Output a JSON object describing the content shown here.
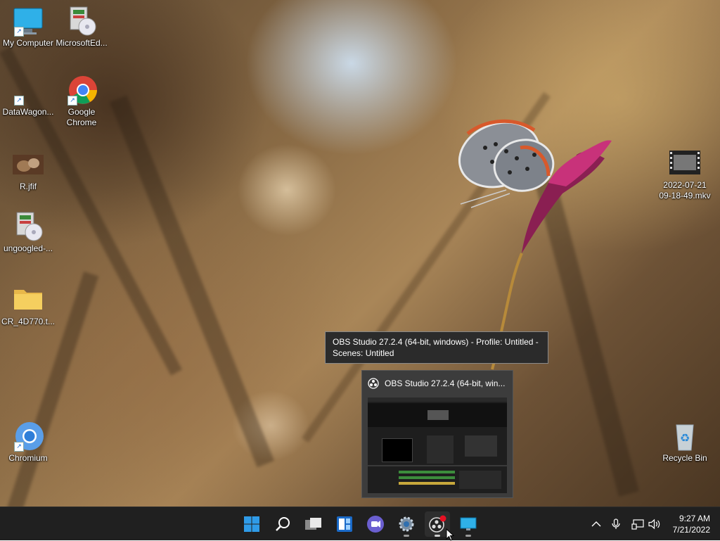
{
  "desktop": {
    "icons": [
      {
        "label": "My Computer",
        "icon": "monitor-icon"
      },
      {
        "label": "MicrosoftEd...",
        "icon": "installer-icon"
      },
      {
        "label": "DataWagon...",
        "icon": "blank-shortcut-icon"
      },
      {
        "label": "Google\nChrome",
        "icon": "chrome-icon"
      },
      {
        "label": "R.jfif",
        "icon": "image-file-icon"
      },
      {
        "label": "ungoogled-...",
        "icon": "installer-icon"
      },
      {
        "label": "CR_4D770.t...",
        "icon": "folder-icon"
      },
      {
        "label": "Chromium",
        "icon": "chromium-icon"
      },
      {
        "label": "2022-07-21\n09-18-49.mkv",
        "icon": "video-file-icon"
      },
      {
        "label": "Recycle Bin",
        "icon": "recycle-bin-icon"
      }
    ]
  },
  "tooltip": {
    "text": "OBS Studio 27.2.4 (64-bit, windows) - Profile: Untitled - Scenes: Untitled"
  },
  "preview": {
    "title": "OBS Studio 27.2.4 (64-bit, win..."
  },
  "taskbar": {
    "apps": [
      {
        "name": "start",
        "icon": "windows-start-icon"
      },
      {
        "name": "search",
        "icon": "search-icon"
      },
      {
        "name": "task-view",
        "icon": "task-view-icon"
      },
      {
        "name": "widgets",
        "icon": "widgets-icon"
      },
      {
        "name": "teams-chat",
        "icon": "chat-icon"
      },
      {
        "name": "settings",
        "icon": "gear-icon"
      },
      {
        "name": "obs-studio",
        "icon": "obs-icon"
      },
      {
        "name": "remote-desktop",
        "icon": "monitor-icon"
      }
    ],
    "tray": {
      "chevron": "chevron-up-icon",
      "mic": "microphone-icon",
      "network": "network-icon",
      "volume": "speaker-icon"
    },
    "clock": {
      "time": "9:27 AM",
      "date": "7/21/2022"
    }
  },
  "colors": {
    "taskbar_bg": "#202020",
    "tooltip_bg": "#2b2b2b",
    "accent": "#0078d4",
    "obs_record": "#e81123"
  }
}
